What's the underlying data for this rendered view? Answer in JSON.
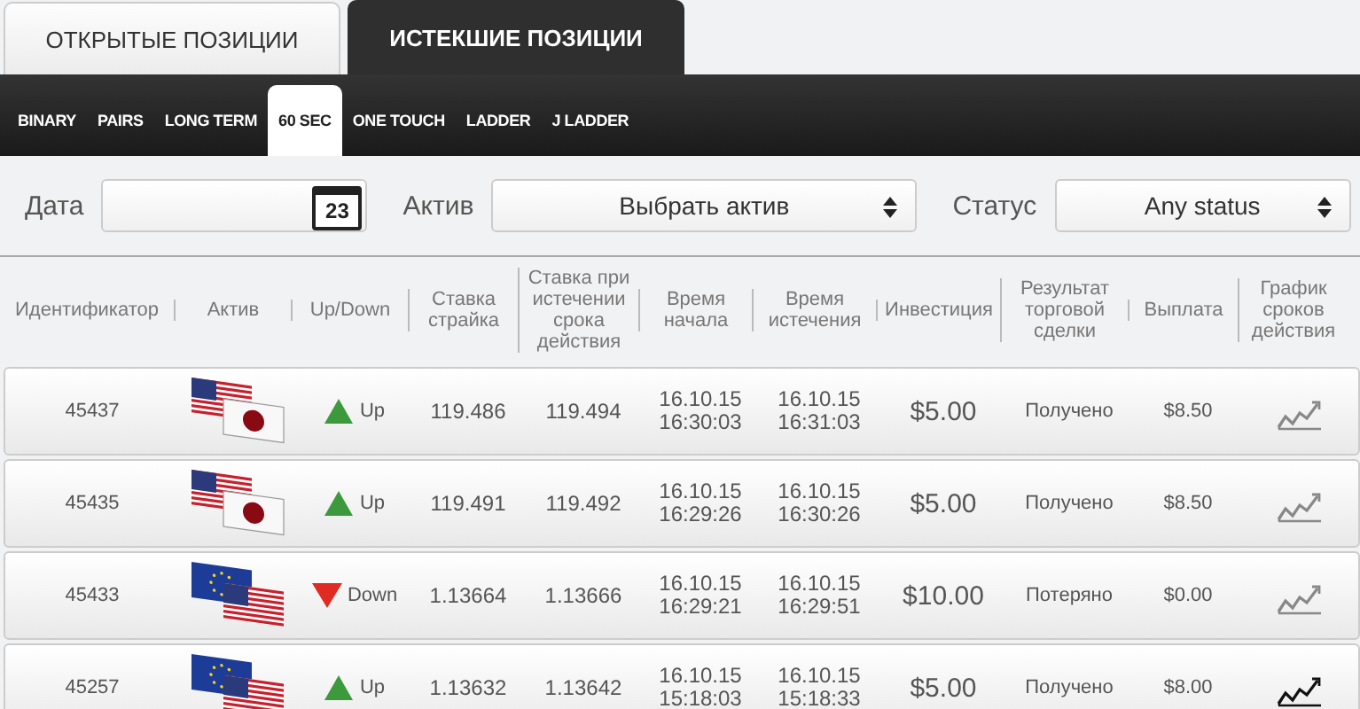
{
  "tabs": [
    {
      "label": "ОТКРЫТЫЕ ПОЗИЦИИ",
      "selected": false
    },
    {
      "label": "ИСТЕКШИЕ ПОЗИЦИИ",
      "selected": true
    }
  ],
  "subtabs": [
    {
      "label": "BINARY",
      "selected": false
    },
    {
      "label": "PAIRS",
      "selected": false
    },
    {
      "label": "LONG TERM",
      "selected": false
    },
    {
      "label": "60 SEC",
      "selected": true
    },
    {
      "label": "ONE TOUCH",
      "selected": false
    },
    {
      "label": "LADDER",
      "selected": false
    },
    {
      "label": "J LADDER",
      "selected": false
    }
  ],
  "filters": {
    "date_label": "Дата",
    "date_icon_day": "23",
    "asset_label": "Актив",
    "asset_value": "Выбрать актив",
    "status_label": "Статус",
    "status_value": "Any status"
  },
  "table": {
    "columns": [
      "Идентификатор",
      "Актив",
      "Up/Down",
      "Ставка страйка",
      "Ставка при истечении срока действия",
      "Время начала",
      "Время истечения",
      "Инвестиция",
      "Результат торговой сделки",
      "Выплата",
      "График сроков действия"
    ],
    "rows": [
      {
        "id": "45437",
        "asset": {
          "kind": "usd-jpy"
        },
        "direction": {
          "kind": "up",
          "label": "Up"
        },
        "strike": "119.486",
        "expiry_rate": "119.494",
        "start": [
          "16.10.15",
          "16:30:03"
        ],
        "end": [
          "16.10.15",
          "16:31:03"
        ],
        "investment": "$5.00",
        "result": "Получено",
        "payout": "$8.50",
        "chart_highlighted": false
      },
      {
        "id": "45435",
        "asset": {
          "kind": "usd-jpy"
        },
        "direction": {
          "kind": "up",
          "label": "Up"
        },
        "strike": "119.491",
        "expiry_rate": "119.492",
        "start": [
          "16.10.15",
          "16:29:26"
        ],
        "end": [
          "16.10.15",
          "16:30:26"
        ],
        "investment": "$5.00",
        "result": "Получено",
        "payout": "$8.50",
        "chart_highlighted": false
      },
      {
        "id": "45433",
        "asset": {
          "kind": "eur-usd"
        },
        "direction": {
          "kind": "down",
          "label": "Down"
        },
        "strike": "1.13664",
        "expiry_rate": "1.13666",
        "start": [
          "16.10.15",
          "16:29:21"
        ],
        "end": [
          "16.10.15",
          "16:29:51"
        ],
        "investment": "$10.00",
        "result": "Потеряно",
        "payout": "$0.00",
        "chart_highlighted": false
      },
      {
        "id": "45257",
        "asset": {
          "kind": "eur-usd"
        },
        "direction": {
          "kind": "up",
          "label": "Up"
        },
        "strike": "1.13632",
        "expiry_rate": "1.13642",
        "start": [
          "16.10.15",
          "15:18:03"
        ],
        "end": [
          "16.10.15",
          "15:18:33"
        ],
        "investment": "$5.00",
        "result": "Получено",
        "payout": "$8.00",
        "chart_highlighted": true
      }
    ]
  }
}
